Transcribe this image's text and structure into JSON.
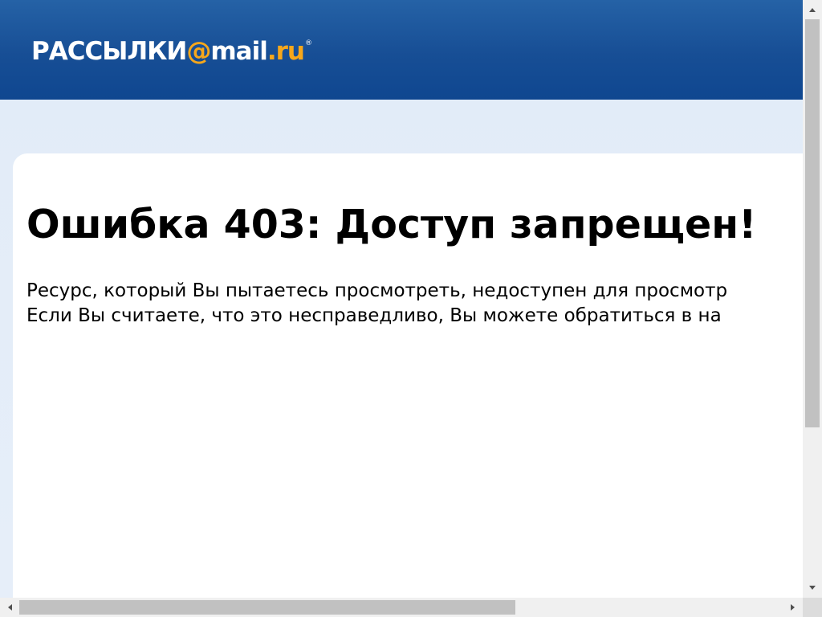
{
  "header": {
    "logo": {
      "part1": "РАССЫЛКИ",
      "at": "@",
      "part2": "mail",
      "dot": ".",
      "part3": "ru",
      "reg": "®"
    }
  },
  "main": {
    "title": "Ошибка 403: Доступ запрещен!",
    "message_lines": [
      "Ресурс, который Вы пытаетесь просмотреть, недоступен для просмотр",
      "Если Вы считаете, что это несправедливо, Вы можете обратиться в на"
    ]
  },
  "scrollbars": {
    "vertical_icons": [
      "chevron-up-icon",
      "chevron-down-icon"
    ],
    "horizontal_icons": [
      "chevron-left-icon",
      "chevron-right-icon"
    ]
  },
  "colors": {
    "header_blue": "#174e95",
    "logo_orange": "#f6a71b",
    "background_light_blue": "#e6eef9"
  }
}
